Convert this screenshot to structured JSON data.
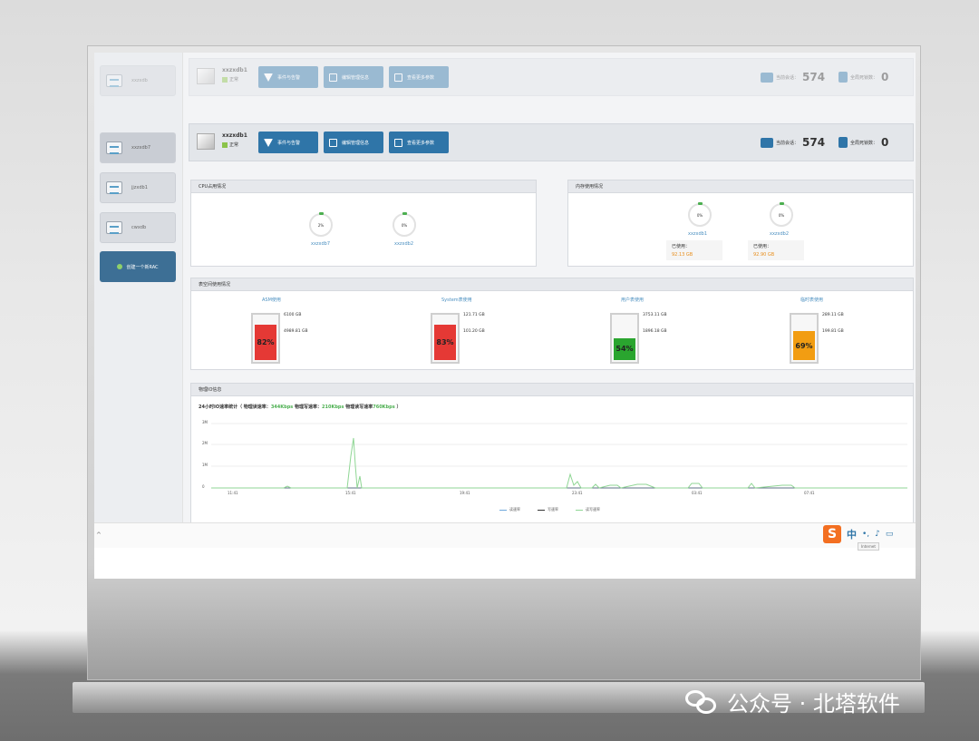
{
  "top_server_ghost": {
    "name": "xxzxdb1",
    "status": "正常",
    "buttons": [
      "事件与告警",
      "编辑管理信息",
      "查看更多参数"
    ],
    "sessions_label": "当前会话：",
    "sessions_value": "574",
    "locks_label": "全局死锁数：",
    "locks_value": "0"
  },
  "server": {
    "name": "xxzxdb1",
    "status": "正常",
    "buttons": [
      "事件与告警",
      "编辑管理信息",
      "查看更多参数"
    ],
    "sessions_label": "当前会话：",
    "sessions_value": "574",
    "locks_label": "全局死锁数：",
    "locks_value": "0"
  },
  "sidebar": {
    "items": [
      {
        "label": "xxzxdb",
        "state": "faded"
      },
      {
        "label": "xxzxdb7",
        "state": "active"
      },
      {
        "label": "jjzxdb1",
        "state": "normal"
      },
      {
        "label": "cwxdb",
        "state": "normal"
      }
    ],
    "create_label": "创建一个新RAC"
  },
  "cpu": {
    "title": "CPU占用情况",
    "nodes": [
      {
        "name": "xxzxdb7",
        "value": "2%"
      },
      {
        "name": "xxzxdb2",
        "value": "0%"
      }
    ]
  },
  "memory": {
    "title": "内存使用情况",
    "nodes": [
      {
        "name": "xxzxdb1",
        "value": "0%",
        "used_label": "已使用：",
        "used": "92.13 GB"
      },
      {
        "name": "xxzxdb2",
        "value": "0%",
        "used_label": "已使用：",
        "used": "92.90 GB"
      }
    ]
  },
  "tablespace": {
    "title": "表空间使用情况",
    "items": [
      {
        "name": "ASM使用",
        "percent": "82%",
        "level": 0.82,
        "total": "6100 GB",
        "used": "4989.81 GB",
        "color": "#e53935"
      },
      {
        "name": "System表使用",
        "percent": "83%",
        "level": 0.83,
        "total": "121.71 GB",
        "used": "101.20 GB",
        "color": "#e53935"
      },
      {
        "name": "用户表使用",
        "percent": "54%",
        "level": 0.54,
        "total": "3753.11 GB",
        "used": "1896.18 GB",
        "color": "#2aa52f"
      },
      {
        "name": "临时表使用",
        "percent": "69%",
        "level": 0.69,
        "total": "289.11 GB",
        "used": "199.81 GB",
        "color": "#f29d12"
      }
    ]
  },
  "io": {
    "title": "物理IO信息",
    "subtitle_prefix": "24小时IO速率统计（ 物理读速率：",
    "read_rate": "344Kbps",
    "write_label": "物理写速率：",
    "write_rate": "210Kbps",
    "rw_label": "物理读写速率",
    "rw_rate": "760Kbps",
    "subtitle_suffix": "）",
    "y_ticks": [
      "3M",
      "2M",
      "1M",
      "0"
    ],
    "x_ticks": [
      "11:41",
      "15:41",
      "19:41",
      "23:41",
      "03:41",
      "07:41"
    ],
    "legend": [
      "读速率",
      "写速率",
      "读写速率"
    ],
    "series_colors": [
      "#6fa8dc",
      "#333333",
      "#8fd694"
    ]
  },
  "ime": {
    "brand": "S",
    "lang": "中",
    "tip": "Internet"
  },
  "watermark": "公众号 · 北塔软件"
}
